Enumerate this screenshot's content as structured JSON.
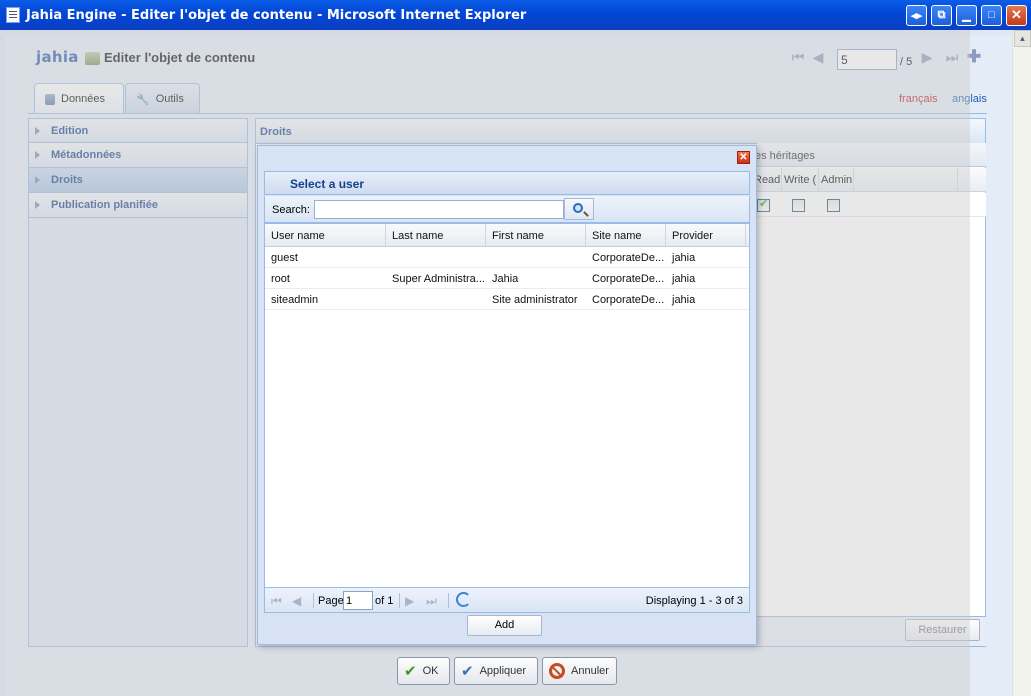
{
  "window": {
    "title": "Jahia Engine - Editer l'objet de contenu - Microsoft Internet Explorer"
  },
  "header": {
    "logo": "jahia",
    "title": "Editer l'objet de contenu"
  },
  "pager": {
    "current": "5",
    "total": "/ 5"
  },
  "tabs": [
    {
      "label": "Données",
      "icon": "database-icon",
      "active": true
    },
    {
      "label": "Outils",
      "icon": "wrench-icon",
      "active": false
    }
  ],
  "languages": {
    "fr": "français",
    "en": "anglais"
  },
  "sidebar": {
    "items": [
      {
        "label": "Edition"
      },
      {
        "label": "Métadonnées"
      },
      {
        "label": "Droits",
        "selected": true
      },
      {
        "label": "Publication planifiée"
      }
    ]
  },
  "main": {
    "title": "Droits",
    "inheritance_label": "es héritages",
    "columns": [
      "Read (",
      "Write (",
      "Admin"
    ],
    "restore_label": "Restaurer"
  },
  "dialog": {
    "title": "Select a user",
    "search_label": "Search:",
    "search_value": "",
    "grid": {
      "columns": [
        "User name",
        "Last name",
        "First name",
        "Site name",
        "Provider"
      ],
      "rows": [
        [
          "guest",
          "",
          "",
          "CorporateDe...",
          "jahia"
        ],
        [
          "root",
          "Super Administra...",
          "Jahia",
          "CorporateDe...",
          "jahia"
        ],
        [
          "siteadmin",
          "",
          "Site administrator",
          "CorporateDe...",
          "jahia"
        ]
      ]
    },
    "paging": {
      "page_label": "Page",
      "page_value": "1",
      "of_label": "of 1",
      "display_info": "Displaying 1 - 3 of 3"
    },
    "add_label": "Add"
  },
  "actions": {
    "ok": "OK",
    "apply": "Appliquer",
    "cancel": "Annuler"
  },
  "colors": {
    "titlebar": "#0a5ce6",
    "panel_border": "#99bbe8",
    "header_text": "#15428b",
    "lang_fr": "#c02020",
    "lang_en": "#1a63b4"
  }
}
